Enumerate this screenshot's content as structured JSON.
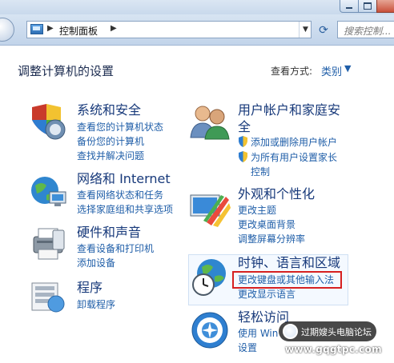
{
  "window": {
    "min_label": "",
    "max_label": "",
    "close_label": ""
  },
  "address": {
    "crumb": "控制面板",
    "search_placeholder": "搜索控制..."
  },
  "header": {
    "title": "调整计算机的设置",
    "view_by_label": "查看方式:",
    "view_by_value": "类别"
  },
  "categories": [
    {
      "title": "系统和安全",
      "links": [
        "查看您的计算机状态",
        "备份您的计算机",
        "查找并解决问题"
      ]
    },
    {
      "title": "网络和 Internet",
      "links": [
        "查看网络状态和任务",
        "选择家庭组和共享选项"
      ]
    },
    {
      "title": "硬件和声音",
      "links": [
        "查看设备和打印机",
        "添加设备"
      ]
    },
    {
      "title": "程序",
      "links": [
        "卸载程序"
      ]
    },
    {
      "title_line1": "用户帐户和家庭安",
      "title_line2": "全",
      "links": [
        "添加或删除用户帐户",
        "为所有用户设置家长",
        "控制"
      ]
    },
    {
      "title": "外观和个性化",
      "links": [
        "更改主题",
        "更改桌面背景",
        "调整屏幕分辨率"
      ]
    },
    {
      "title": "时钟、语言和区域",
      "links": [
        "更改键盘或其他输入法",
        "更改显示语言"
      ]
    },
    {
      "title": "轻松访问",
      "links": [
        "使用 Win",
        "设置"
      ]
    }
  ],
  "watermark": {
    "badge_text": "过期嫂头电脑论坛",
    "site": "www.gqgtpc.com"
  },
  "colors": {
    "link": "#1f5ea8",
    "title": "#17397a",
    "highlight_border": "#d62020"
  }
}
